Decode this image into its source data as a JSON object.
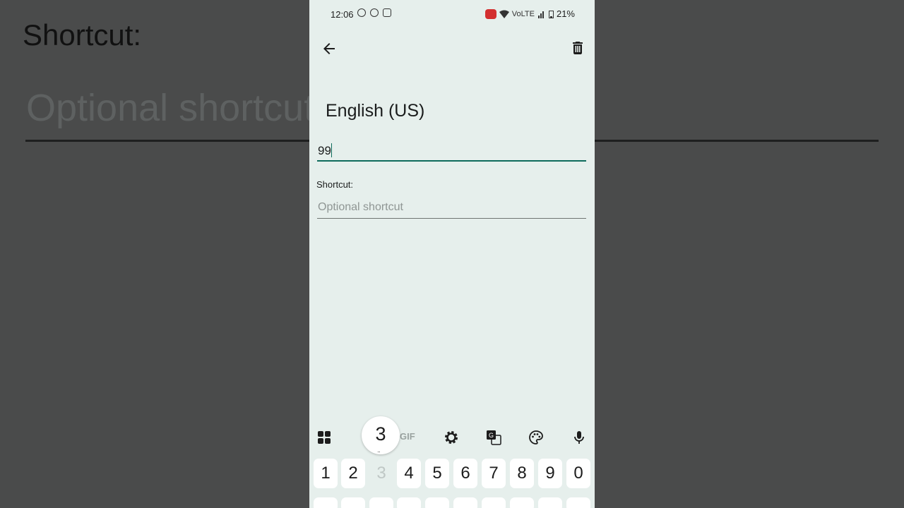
{
  "background": {
    "shortcut_label": "Shortcut:",
    "placeholder": "Optional shortcut"
  },
  "status_bar": {
    "time": "12:06",
    "battery": "21%",
    "network": "VoLTE"
  },
  "editor": {
    "language": "English (US)",
    "word_value": "99",
    "shortcut_label": "Shortcut:",
    "shortcut_placeholder": "Optional shortcut"
  },
  "keyboard": {
    "gif_label": "GIF",
    "popup_key": "3",
    "popup_more": "...",
    "number_row": [
      "1",
      "2",
      "3",
      "4",
      "5",
      "6",
      "7",
      "8",
      "9",
      "0"
    ]
  },
  "colors": {
    "accent": "#0e6b5c",
    "surface": "#e6efec",
    "recording": "#d32f2f"
  },
  "icons": [
    "back-arrow-icon",
    "trash-icon",
    "apps-grid-icon",
    "gear-icon",
    "translate-icon",
    "palette-icon",
    "microphone-icon"
  ]
}
